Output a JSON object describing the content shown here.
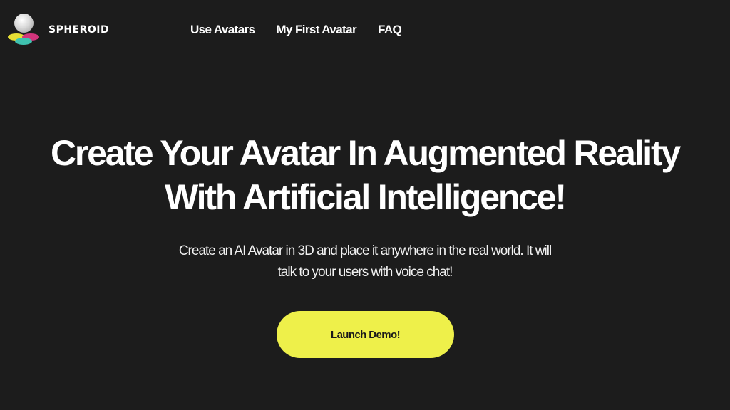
{
  "header": {
    "brand": "SPHEROID",
    "logo_icon": "spheroid-logo-icon",
    "nav": [
      {
        "label": "Use Avatars"
      },
      {
        "label": "My First Avatar"
      },
      {
        "label": "FAQ"
      }
    ]
  },
  "hero": {
    "title_line1": "Create Your Avatar In Augmented Reality",
    "title_line2": "With Artificial Intelligence!",
    "subtitle_line1": "Create an AI Avatar in 3D and place it anywhere in the real world. It will",
    "subtitle_line2": "talk to your users with voice chat!",
    "cta_label": "Launch Demo!"
  },
  "colors": {
    "background": "#1c1c1c",
    "cta": "#eef04a",
    "logo_yellow": "#e6df35",
    "logo_pink": "#d2357c",
    "logo_teal": "#3fc2b0"
  }
}
